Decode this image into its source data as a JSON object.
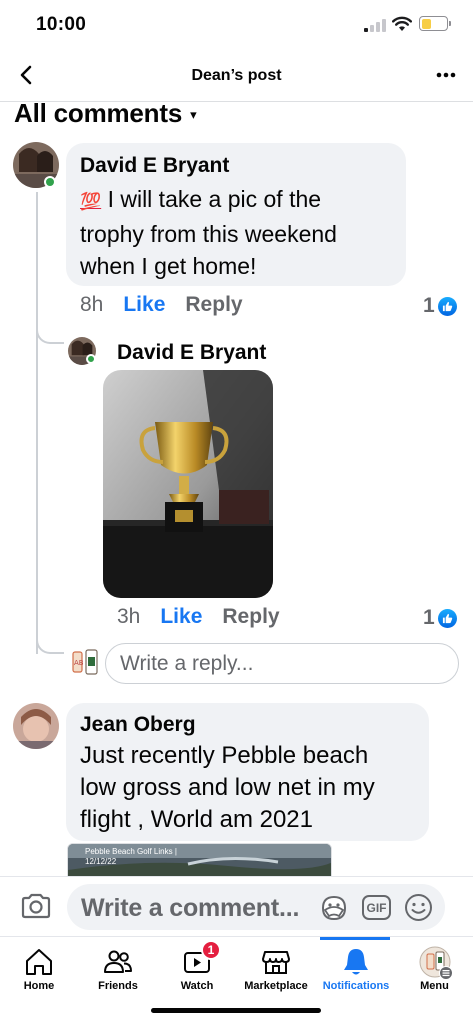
{
  "status_bar": {
    "time": "10:00"
  },
  "header": {
    "title": "Dean’s post"
  },
  "section": {
    "title": "All comments"
  },
  "comments": [
    {
      "author": "David E Bryant",
      "emoji": "💯",
      "lines": [
        "I will take a pic of the",
        "trophy from this weekend",
        "when I get home!"
      ],
      "time": "8h",
      "like_label": "Like",
      "reply_label": "Reply",
      "reaction_count": "1"
    },
    {
      "author": "Jean Oberg",
      "lines": [
        "Just recently Pebble beach",
        "low gross and low net in my",
        "flight , World am 2021"
      ],
      "preview_caption_1": "Pebble Beach Golf Links |",
      "preview_caption_2": "12/12/22"
    }
  ],
  "reply": {
    "author": "David E Bryant",
    "time": "3h",
    "like_label": "Like",
    "reply_label": "Reply",
    "reaction_count": "1",
    "input_placeholder": "Write a reply..."
  },
  "composer": {
    "placeholder": "Write a comment...",
    "gif_label": "GIF"
  },
  "tabs": [
    {
      "label": "Home"
    },
    {
      "label": "Friends"
    },
    {
      "label": "Watch",
      "badge": "1"
    },
    {
      "label": "Marketplace"
    },
    {
      "label": "Notifications"
    },
    {
      "label": "Menu"
    }
  ],
  "colors": {
    "accent": "#1877f2",
    "bubble": "#f0f2f5",
    "online": "#31a24c",
    "badge": "#e41e3f"
  }
}
